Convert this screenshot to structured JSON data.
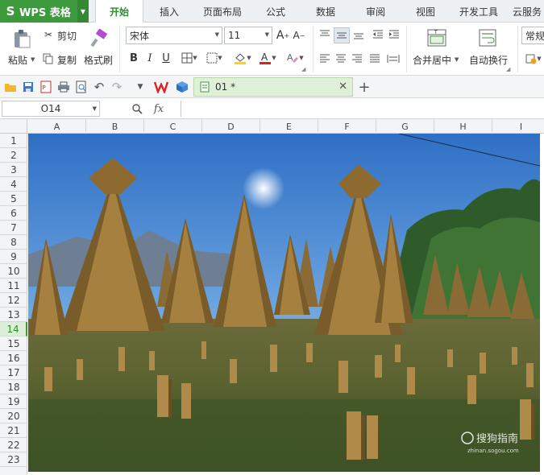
{
  "app": {
    "name": "WPS 表格",
    "logo_letter": "S"
  },
  "menu_tabs": [
    "开始",
    "插入",
    "页面布局",
    "公式",
    "数据",
    "审阅",
    "视图",
    "开发工具",
    "云服务"
  ],
  "ribbon": {
    "paste": "粘贴",
    "cut": "剪切",
    "copy": "复制",
    "format_painter": "格式刷",
    "font_name": "宋体",
    "font_size": "11",
    "bold": "B",
    "italic": "I",
    "underline": "U",
    "merge_center": "合并居中",
    "wrap_text": "自动换行",
    "number_format": "常规"
  },
  "document_tab": {
    "title": "01 *"
  },
  "formula_bar": {
    "cell_ref": "O14",
    "fx": "fx"
  },
  "columns": [
    "A",
    "B",
    "C",
    "D",
    "E",
    "F",
    "G",
    "H",
    "I"
  ],
  "rows": [
    "1",
    "2",
    "3",
    "4",
    "5",
    "6",
    "7",
    "8",
    "9",
    "10",
    "11",
    "12",
    "13",
    "14",
    "15",
    "16",
    "17",
    "18",
    "19",
    "20",
    "21",
    "22",
    "23"
  ],
  "selected_row": "14",
  "image_watermark": {
    "text": "搜狗指南",
    "sub": "zhinan.sogou.com"
  },
  "colors": {
    "accent": "#3c9a3c",
    "selected_row_bg": "#dcefd6",
    "doc_tab_bg": "#dff0d8"
  }
}
